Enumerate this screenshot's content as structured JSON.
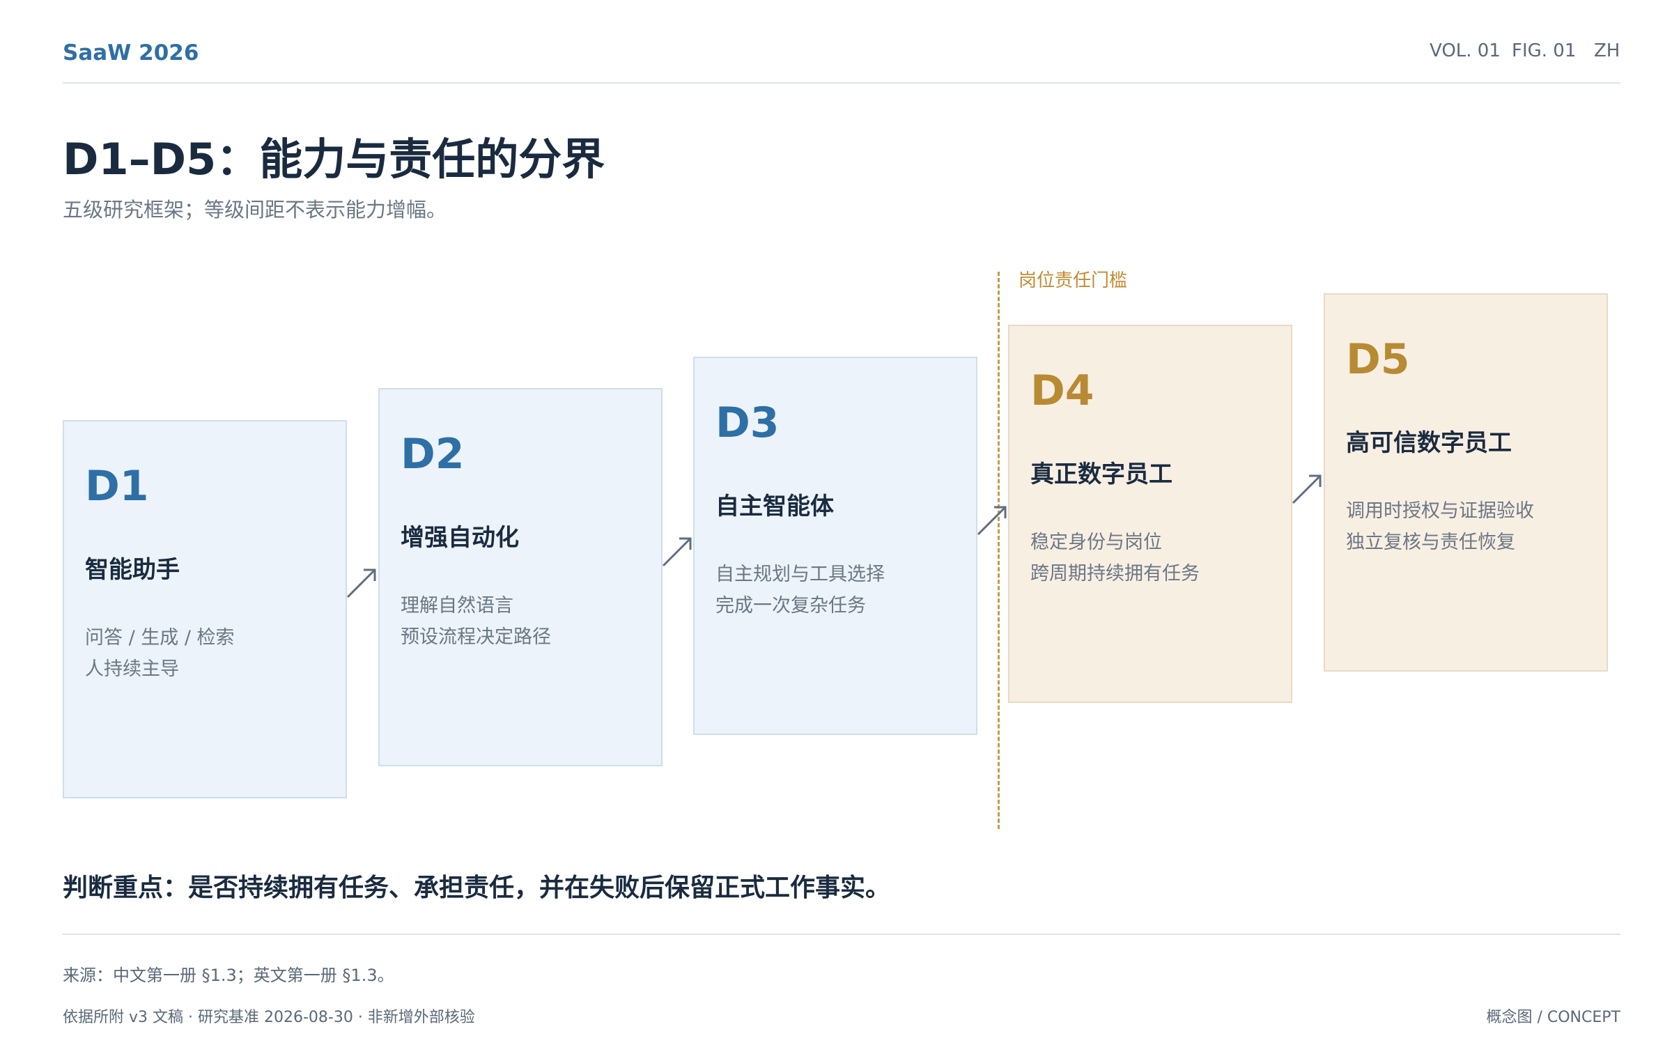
{
  "header": {
    "brand": "SaaW 2026",
    "vol": "VOL. 01",
    "fig": "FIG. 01",
    "lang": "ZH"
  },
  "title": "D1–D5：能力与责任的分界",
  "subtitle": "五级研究框架；等级间距不表示能力增幅。",
  "threshold_label": "岗位责任门槛",
  "levels": [
    {
      "code": "D1",
      "name": "智能助手",
      "desc1": "问答 / 生成 / 检索",
      "desc2": "人持续主导"
    },
    {
      "code": "D2",
      "name": "增强自动化",
      "desc1": "理解自然语言",
      "desc2": "预设流程决定路径"
    },
    {
      "code": "D3",
      "name": "自主智能体",
      "desc1": "自主规划与工具选择",
      "desc2": "完成一次复杂任务"
    },
    {
      "code": "D4",
      "name": "真正数字员工",
      "desc1": "稳定身份与岗位",
      "desc2": "跨周期持续拥有任务"
    },
    {
      "code": "D5",
      "name": "高可信数字员工",
      "desc1": "调用时授权与证据验收",
      "desc2": "独立复核与责任恢复"
    }
  ],
  "judgement": "判断重点：是否持续拥有任务、承担责任，并在失败后保留正式工作事实。",
  "source": "来源：中文第一册 §1.3；英文第一册 §1.3。",
  "footer": {
    "left": "依据所附 v3 文稿 · 研究基准 2026-08-30 · 非新增外部核验",
    "right": "概念图 / CONCEPT"
  },
  "colors": {
    "blue_accent": "#2e6fa5",
    "gold_accent": "#b88a33",
    "blue_card_bg": "#ecf3fa",
    "gold_card_bg": "#f8efe3"
  }
}
